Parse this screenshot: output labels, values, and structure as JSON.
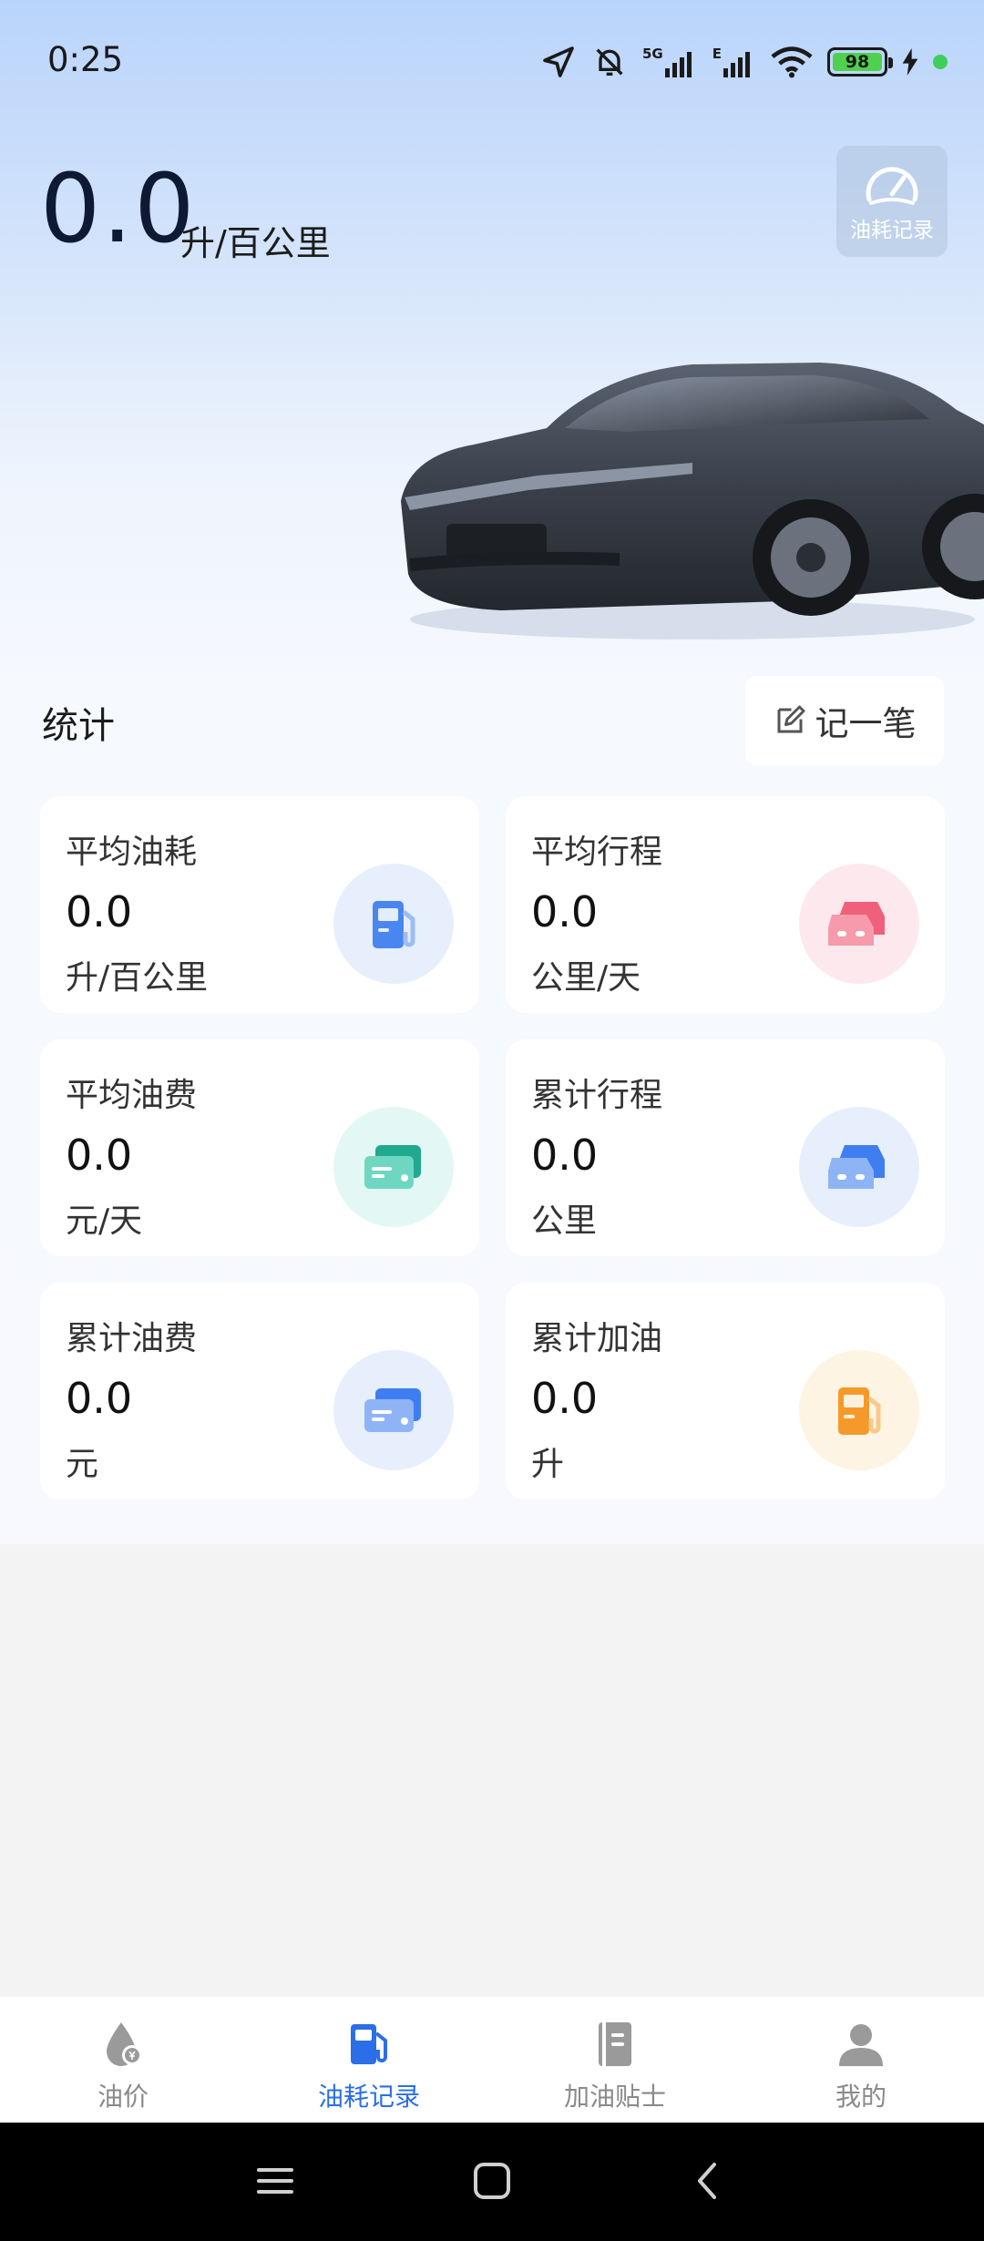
{
  "status_bar": {
    "time": "0:25",
    "network_label": "5G",
    "network_label_2": "E",
    "battery": "98"
  },
  "header": {
    "consumption_value": "0.0",
    "consumption_unit": "升/百公里",
    "record_button_label": "油耗记录"
  },
  "stats": {
    "title": "统计",
    "add_record_label": "记一笔",
    "cards": [
      {
        "title": "平均油耗",
        "value": "0.0",
        "unit": "升/百公里",
        "icon": "fuel-pump-icon",
        "color": "#4a86f0",
        "bg": "#e7effd"
      },
      {
        "title": "平均行程",
        "value": "0.0",
        "unit": "公里/天",
        "icon": "car-icon",
        "color": "#f0607a",
        "bg": "#fde9ed"
      },
      {
        "title": "平均油费",
        "value": "0.0",
        "unit": "元/天",
        "icon": "wallet-icon",
        "color": "#20b49a",
        "bg": "#e3f8f4"
      },
      {
        "title": "累计行程",
        "value": "0.0",
        "unit": "公里",
        "icon": "car-icon",
        "color": "#4a86f0",
        "bg": "#e7effd"
      },
      {
        "title": "累计油费",
        "value": "0.0",
        "unit": "元",
        "icon": "wallet-icon",
        "color": "#4a86f0",
        "bg": "#e7effd"
      },
      {
        "title": "累计加油",
        "value": "0.0",
        "unit": "升",
        "icon": "fuel-pump-icon",
        "color": "#f59a2a",
        "bg": "#fef4e4"
      }
    ]
  },
  "nav": {
    "items": [
      {
        "label": "油价",
        "icon": "oil-drop-icon",
        "active": false
      },
      {
        "label": "油耗记录",
        "icon": "fuel-pump-icon",
        "active": true
      },
      {
        "label": "加油贴士",
        "icon": "notebook-icon",
        "active": false
      },
      {
        "label": "我的",
        "icon": "user-icon",
        "active": false
      }
    ]
  },
  "colors": {
    "accent": "#2a6fe8",
    "inactive": "#8a8a8a"
  }
}
